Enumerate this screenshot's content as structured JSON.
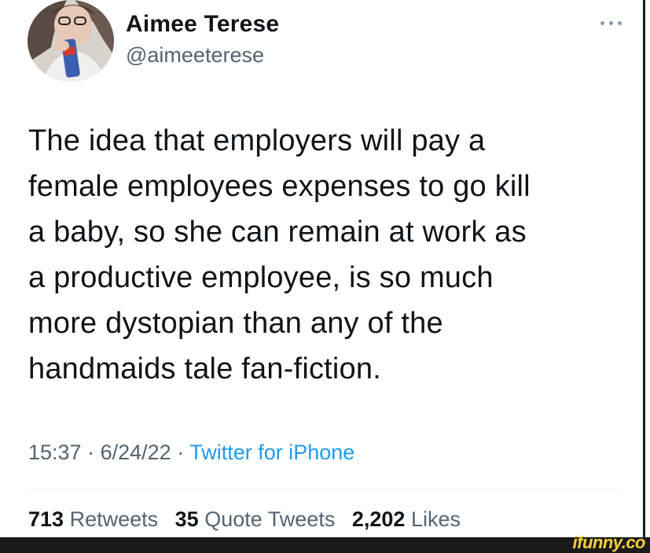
{
  "author": {
    "display_name": "Aimee Terese",
    "handle": "@aimeeterese",
    "avatar_icon": "profile-photo"
  },
  "more_icon": "more-options-icon",
  "tweet": {
    "lines": [
      "The idea that employers will pay a",
      "female employees expenses to go kill",
      "a baby, so she can remain at work as",
      "a productive employee, is so much",
      "more dystopian than any of the",
      "handmaids tale fan-fiction."
    ],
    "time": "15:37",
    "date": "6/24/22",
    "separator": "·",
    "source": "Twitter for iPhone"
  },
  "stats": {
    "retweets_count": "713",
    "retweets_label": "Retweets",
    "quotes_count": "35",
    "quotes_label": "Quote Tweets",
    "likes_count": "2,202",
    "likes_label": "Likes"
  },
  "watermark": "ifunny.co",
  "colors": {
    "text": "#0f1419",
    "secondary": "#536471",
    "link": "#1d9bf0",
    "watermark": "#f6cf3a"
  }
}
